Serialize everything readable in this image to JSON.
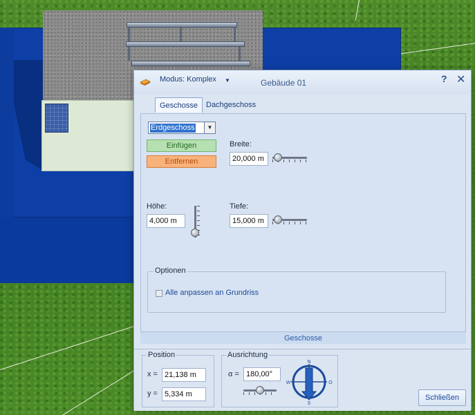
{
  "dialog": {
    "mode_label": "Modus: Komplex",
    "title": "Gebäude 01",
    "help_label": "?",
    "close_label": "✕"
  },
  "tabs": [
    {
      "label": "Geschosse",
      "active": true
    },
    {
      "label": "Dachgeschoss",
      "active": false
    }
  ],
  "floor": {
    "selected": "Erdgeschoss",
    "insert_label": "Einfügen",
    "remove_label": "Entfernen"
  },
  "fields": {
    "width": {
      "label": "Breite:",
      "value": "20,000 m"
    },
    "height": {
      "label": "Höhe:",
      "value": "4,000 m"
    },
    "depth": {
      "label": "Tiefe:",
      "value": "15,000 m"
    }
  },
  "options": {
    "legend": "Optionen",
    "fit_to_outline_label": "Alle anpassen an Grundriss",
    "fit_to_outline_checked": false
  },
  "section_footer": "Geschosse",
  "position": {
    "legend": "Position",
    "x_label": "x =",
    "x_value": "21,138 m",
    "y_label": "y =",
    "y_value": "5,334 m"
  },
  "orientation": {
    "legend": "Ausrichtung",
    "alpha_label": "α =",
    "alpha_value": "180,00°",
    "compass": {
      "n": "N",
      "o": "O",
      "s": "S",
      "w": "W"
    }
  },
  "close_button": "Schließen",
  "colors": {
    "accent": "#1c4b9a",
    "insert_bg": "#b6e0b1",
    "remove_bg": "#f8b37a",
    "building_blue": "#0d3fa6",
    "grass": "#4a8a28"
  }
}
